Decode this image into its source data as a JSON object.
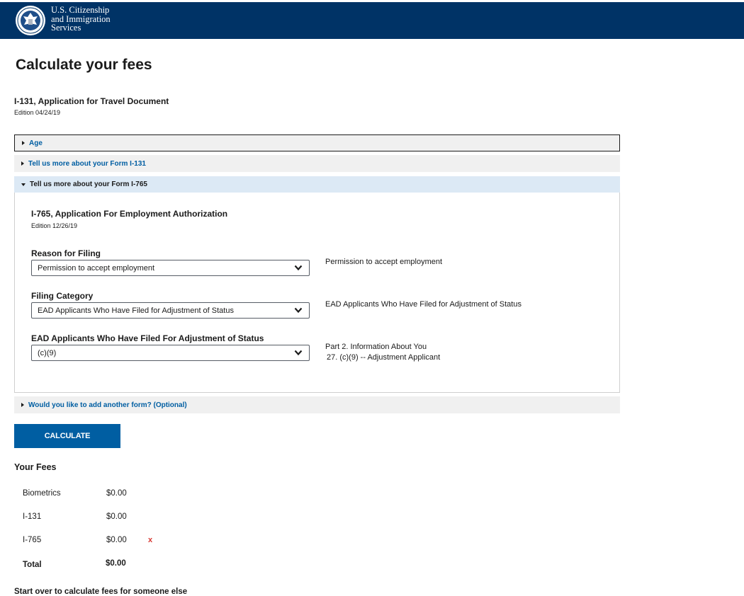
{
  "header": {
    "agency_line1": "U.S. Citizenship",
    "agency_line2": "and Immigration",
    "agency_line3": "Services",
    "bg_color": "#003366",
    "seal_icon": "dhs-seal-icon"
  },
  "page": {
    "title": "Calculate your fees"
  },
  "form": {
    "title": "I-131, Application for Travel Document",
    "edition": "Edition 04/24/19"
  },
  "accordions": {
    "age": "Age",
    "i131": "Tell us more about your Form I-131",
    "i765": "Tell us more about your Form I-765",
    "add_form": "Would you like to add another form? (Optional)"
  },
  "i765_panel": {
    "title": "I-765, Application For Employment Authorization",
    "edition": "Edition 12/26/19",
    "fields": [
      {
        "label": "Reason for Filing",
        "value": "Permission to accept employment",
        "description": "Permission to accept employment"
      },
      {
        "label": "Filing Category",
        "value": "EAD Applicants Who Have Filed for Adjustment of Status",
        "description": "EAD Applicants Who Have Filed for Adjustment of Status"
      },
      {
        "label": "EAD Applicants Who Have Filed For Adjustment of Status",
        "value": "(c)(9)",
        "description_line1": "Part 2. Information About You",
        "description_line2": "27. (c)(9) -- Adjustment Applicant"
      }
    ]
  },
  "calculate_label": "CALCULATE",
  "fees": {
    "heading": "Your Fees",
    "rows": [
      {
        "name": "Biometrics",
        "amount": "$0.00"
      },
      {
        "name": "I-131",
        "amount": "$0.00"
      },
      {
        "name": "I-765",
        "amount": "$0.00",
        "remove": "x"
      }
    ],
    "total_label": "Total",
    "total_amount": "$0.00"
  },
  "start_over": "Start over to calculate fees for someone else",
  "colors": {
    "primary": "#005ea2",
    "accordion_bg": "#f0f0f0",
    "accordion_open_bg": "#dce9f5",
    "remove_red": "#d83933"
  }
}
